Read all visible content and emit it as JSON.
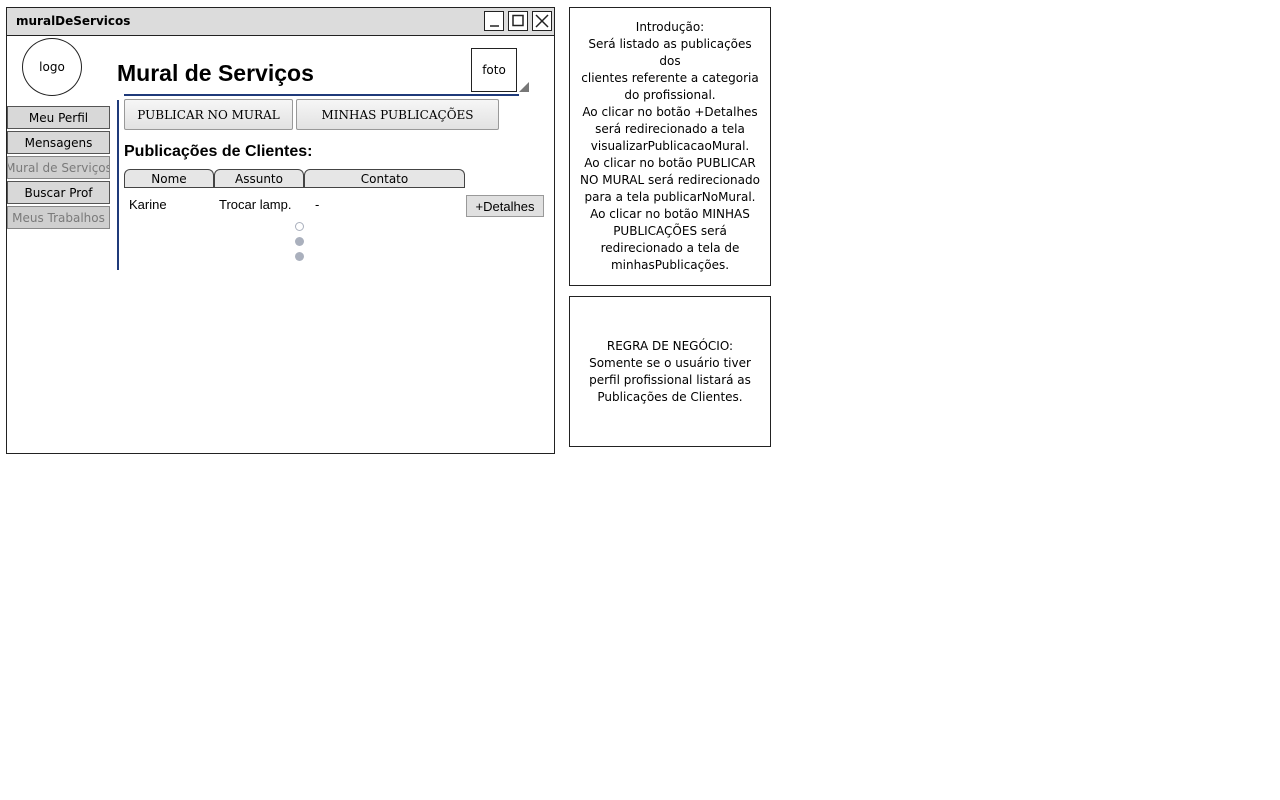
{
  "window": {
    "title": "muralDeServicos",
    "minimize_icon": "minimize-icon",
    "maximize_icon": "maximize-icon",
    "close_icon": "close-icon"
  },
  "header": {
    "logo_label": "logo",
    "page_title": "Mural de Serviços",
    "photo_label": "foto"
  },
  "sidebar": {
    "items": [
      {
        "label": "Meu Perfil",
        "disabled": false
      },
      {
        "label": "Mensagens",
        "disabled": false
      },
      {
        "label": "Mural de Serviços",
        "disabled": true
      },
      {
        "label": "Buscar Prof",
        "disabled": false
      },
      {
        "label": "Meus Trabalhos",
        "disabled": true
      }
    ]
  },
  "actions": {
    "publish_label": "PUBLICAR NO MURAL",
    "my_posts_label": "MINHAS PUBLICAÇÕES"
  },
  "publications": {
    "section_title": "Publicações de Clientes:",
    "columns": [
      "Nome",
      "Assunto",
      "Contato"
    ],
    "rows": [
      {
        "nome": "Karine",
        "assunto": "Trocar lamp.",
        "contato": "-",
        "action_label": "+Detalhes"
      }
    ],
    "pager": {
      "pages": 3,
      "current": 1
    }
  },
  "notes": {
    "intro": "Introdução:\nSerá listado as publicações dos\nclientes referente a categoria\ndo profissional.\nAo clicar no botão +Detalhes\nserá redirecionado a tela\nvisualizarPublicacaoMural.\nAo clicar no botão PUBLICAR\nNO MURAL será redirecionado\npara a tela publicarNoMural.\nAo clicar no botão MINHAS\nPUBLICAÇÕES será\nredirecionado a tela de\nminhasPublicações.",
    "business_rule": "REGRA DE NEGÓCIO:\nSomente se o usuário tiver\nperfil profissional listará as\nPublicações de Clientes."
  }
}
